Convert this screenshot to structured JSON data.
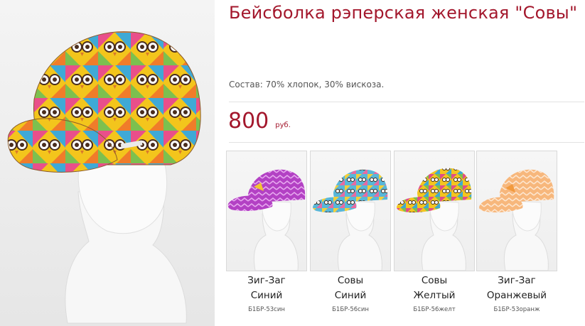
{
  "product": {
    "title": "Бейсболка рэперская женская \"Совы\"",
    "composition": "Состав: 70% хлопок, 30% вискоза.",
    "price": "800",
    "currency": "руб."
  },
  "colors": {
    "accent": "#a3172c"
  },
  "variants": [
    {
      "name_line1": "Зиг-Заг",
      "name_line2": "Синий",
      "sku": "Б1БР-53син",
      "pattern": "zigzag-purple"
    },
    {
      "name_line1": "Совы",
      "name_line2": "Синий",
      "sku": "Б1БР-56син",
      "pattern": "owls-blue"
    },
    {
      "name_line1": "Совы",
      "name_line2": "Желтый",
      "sku": "Б1БР-56желт",
      "pattern": "owls-yellow"
    },
    {
      "name_line1": "Зиг-Заг",
      "name_line2": "Оранжевый",
      "sku": "Б1БР-53оранж",
      "pattern": "zigzag-orange"
    }
  ]
}
